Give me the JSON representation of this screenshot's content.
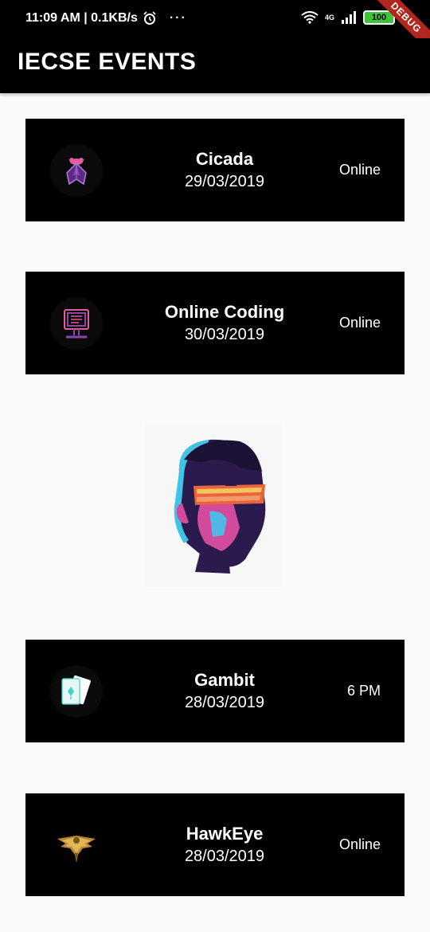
{
  "status_bar": {
    "time": "11:09 AM | 0.1KB/s",
    "network": "4G",
    "battery": "100",
    "debug": "DEBUG"
  },
  "app_bar": {
    "title": "IECSE EVENTS"
  },
  "events": [
    {
      "name": "Cicada",
      "date": "29/03/2019",
      "mode": "Online",
      "icon": "cicada-icon"
    },
    {
      "name": "Online Coding",
      "date": "30/03/2019",
      "mode": "Online",
      "icon": "computer-icon"
    },
    {
      "name": "Gambit",
      "date": "28/03/2019",
      "mode": "6 PM",
      "icon": "cards-icon"
    },
    {
      "name": "HawkEye",
      "date": "28/03/2019",
      "mode": "Online",
      "icon": "hawk-icon"
    }
  ],
  "colors": {
    "background": "#fafafa",
    "card": "#000000",
    "accent_purple": "#8e44ad",
    "accent_cyan": "#3dd6c6",
    "battery_green": "#3ec43a"
  }
}
